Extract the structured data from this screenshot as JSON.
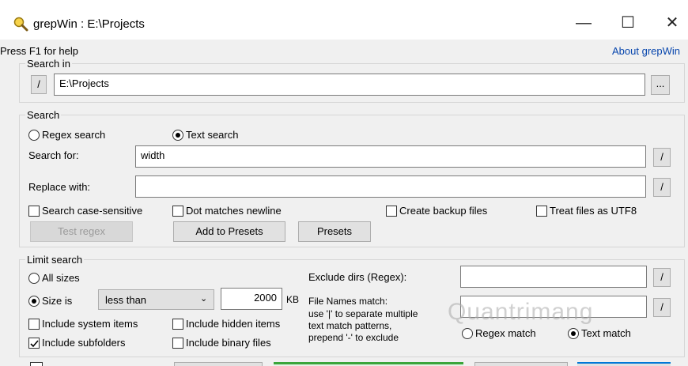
{
  "window": {
    "title": "grepWin : E:\\Projects",
    "minimize": "—",
    "maximize": "☐",
    "close": "✕"
  },
  "help": {
    "text": "Press F1 for help",
    "about": "About grepWin"
  },
  "search_in": {
    "label": "Search in",
    "slash": "/",
    "path": "E:\\Projects",
    "browse": "..."
  },
  "search": {
    "label": "Search",
    "regex_radio": "Regex search",
    "text_radio": "Text search",
    "search_for_label": "Search for:",
    "search_for_value": "width",
    "replace_label": "Replace with:",
    "replace_value": "",
    "slash1": "/",
    "slash2": "/",
    "case_sensitive": "Search case-sensitive",
    "dot_newline": "Dot matches newline",
    "backup": "Create backup files",
    "utf8": "Treat files as UTF8",
    "test_regex": "Test regex",
    "add_presets": "Add to Presets",
    "presets": "Presets"
  },
  "limit": {
    "label": "Limit search",
    "all_sizes": "All sizes",
    "size_is": "Size is",
    "size_op": "less than",
    "size_value": "2000",
    "size_unit": "KB",
    "system_items": "Include system items",
    "hidden_items": "Include hidden items",
    "subfolders": "Include subfolders",
    "binary_files": "Include binary files",
    "exclude_label": "Exclude dirs (Regex):",
    "exclude_value": "",
    "names_title": "File Names match:",
    "names_hint1": "use '|' to separate multiple",
    "names_hint2": "text match patterns,",
    "names_hint3": "prepend '-' to exclude",
    "names_value": "",
    "slash3": "/",
    "slash4": "/",
    "regex_match": "Regex match",
    "text_match": "Text match"
  },
  "watermark": "Quantrimang"
}
